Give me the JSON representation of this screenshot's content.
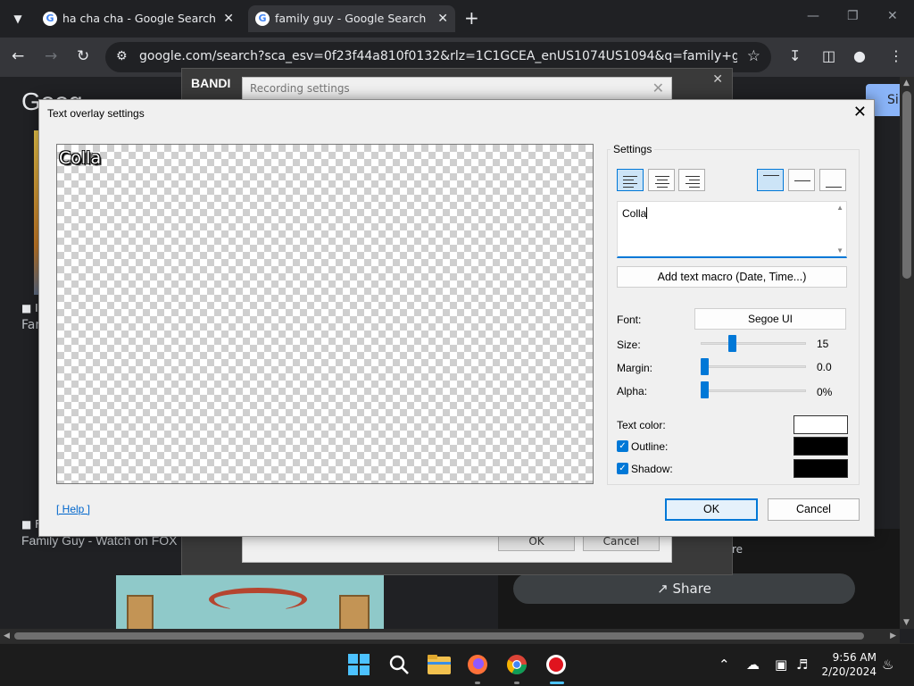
{
  "browser": {
    "tabs": [
      {
        "label": "ha cha cha - Google Search"
      },
      {
        "label": "family guy - Google Search"
      }
    ],
    "url": "google.com/search?sca_esv=0f23f44a810f0132&rlz=1C1GCEA_enUS1074US1094&q=family+guy&tbm=isc..."
  },
  "page": {
    "logo": "Goog",
    "signin": "Si",
    "result1_title": "Fam",
    "result2_title": "Family Guy - Watch on FOX",
    "share_label": "Share",
    "right_text": "re"
  },
  "bandicam": {
    "logo": "BANDI",
    "recording_title": "Recording settings",
    "ok": "OK",
    "cancel": "Cancel"
  },
  "dialog": {
    "title": "Text overlay settings",
    "preview_text": "Colla",
    "settings_legend": "Settings",
    "text_value": "Colla",
    "macro_button": "Add text macro (Date, Time...)",
    "font_label": "Font:",
    "font_value": "Segoe UI",
    "size_label": "Size:",
    "size_value": "15",
    "size_fraction": 0.28,
    "margin_label": "Margin:",
    "margin_value": "0.0",
    "margin_fraction": 0.0,
    "alpha_label": "Alpha:",
    "alpha_value": "0%",
    "alpha_fraction": 0.0,
    "text_color_label": "Text color:",
    "text_color": "#ffffff",
    "outline_label": "Outline:",
    "outline_checked": true,
    "outline_color": "#000000",
    "shadow_label": "Shadow:",
    "shadow_checked": true,
    "shadow_color": "#000000",
    "help_link": "[ Help ]",
    "ok": "OK",
    "cancel": "Cancel"
  },
  "taskbar": {
    "time": "9:56 AM",
    "date": "2/20/2024"
  }
}
